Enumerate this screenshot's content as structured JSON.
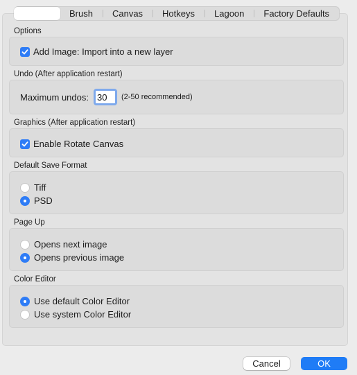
{
  "tabs": [
    {
      "label": "",
      "selected": true
    },
    {
      "label": "Brush",
      "selected": false
    },
    {
      "label": "Canvas",
      "selected": false
    },
    {
      "label": "Hotkeys",
      "selected": false
    },
    {
      "label": "Lagoon",
      "selected": false
    },
    {
      "label": "Factory Defaults",
      "selected": false
    }
  ],
  "sections": {
    "options": {
      "label": "Options",
      "add_image": {
        "label": "Add Image: Import into a new layer",
        "checked": true
      }
    },
    "undo": {
      "label": "Undo (After application restart)",
      "max_undos_label": "Maximum undos:",
      "max_undos_value": "30",
      "hint": "(2-50 recommended)"
    },
    "graphics": {
      "label": "Graphics (After application restart)",
      "rotate_canvas": {
        "label": "Enable Rotate Canvas",
        "checked": true
      }
    },
    "save_format": {
      "label": "Default Save Format",
      "options": [
        {
          "label": "Tiff",
          "selected": false
        },
        {
          "label": "PSD",
          "selected": true
        }
      ]
    },
    "page_up": {
      "label": "Page Up",
      "options": [
        {
          "label": "Opens next image",
          "selected": false
        },
        {
          "label": "Opens previous image",
          "selected": true
        }
      ]
    },
    "color_editor": {
      "label": "Color Editor",
      "options": [
        {
          "label": "Use default Color Editor",
          "selected": true
        },
        {
          "label": "Use system Color Editor",
          "selected": false
        }
      ]
    }
  },
  "buttons": {
    "cancel": "Cancel",
    "ok": "OK"
  },
  "colors": {
    "accent": "#1f7cf6"
  }
}
